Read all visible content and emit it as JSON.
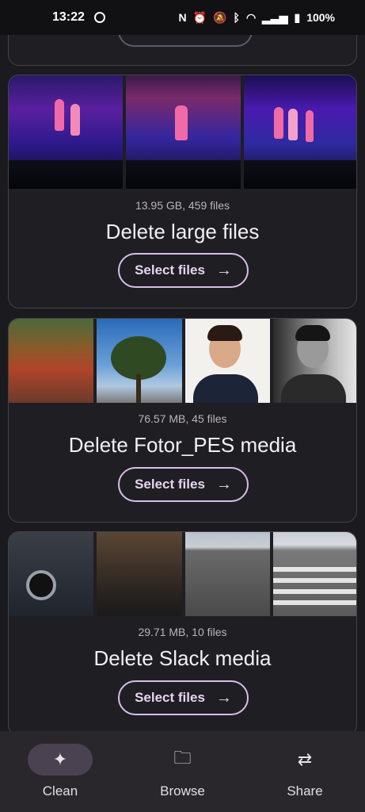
{
  "status_bar": {
    "time": "13:22",
    "battery": "100%",
    "icons": [
      "messenger-icon",
      "nfc-icon",
      "alarm-icon",
      "mute-icon",
      "bluetooth-icon",
      "wifi-icon",
      "signal-icon",
      "battery-icon"
    ]
  },
  "cards": [
    {
      "meta": "13.95 GB, 459 files",
      "title": "Delete large files",
      "button": "Select files"
    },
    {
      "meta": "76.57 MB, 45 files",
      "title": "Delete Fotor_PES media",
      "button": "Select files"
    },
    {
      "meta": "29.71 MB, 10 files",
      "title": "Delete Slack media",
      "button": "Select files"
    }
  ],
  "nav": {
    "items": [
      {
        "label": "Clean",
        "icon": "sparkle-icon",
        "active": true
      },
      {
        "label": "Browse",
        "icon": "folder-search-icon",
        "active": false
      },
      {
        "label": "Share",
        "icon": "swap-arrows-icon",
        "active": false
      }
    ]
  },
  "colors": {
    "background": "#1b1a1e",
    "card": "#1f1e22",
    "accent": "#d7bde8",
    "nav_bar": "#2a272c",
    "nav_active_pill": "#4a4250"
  }
}
